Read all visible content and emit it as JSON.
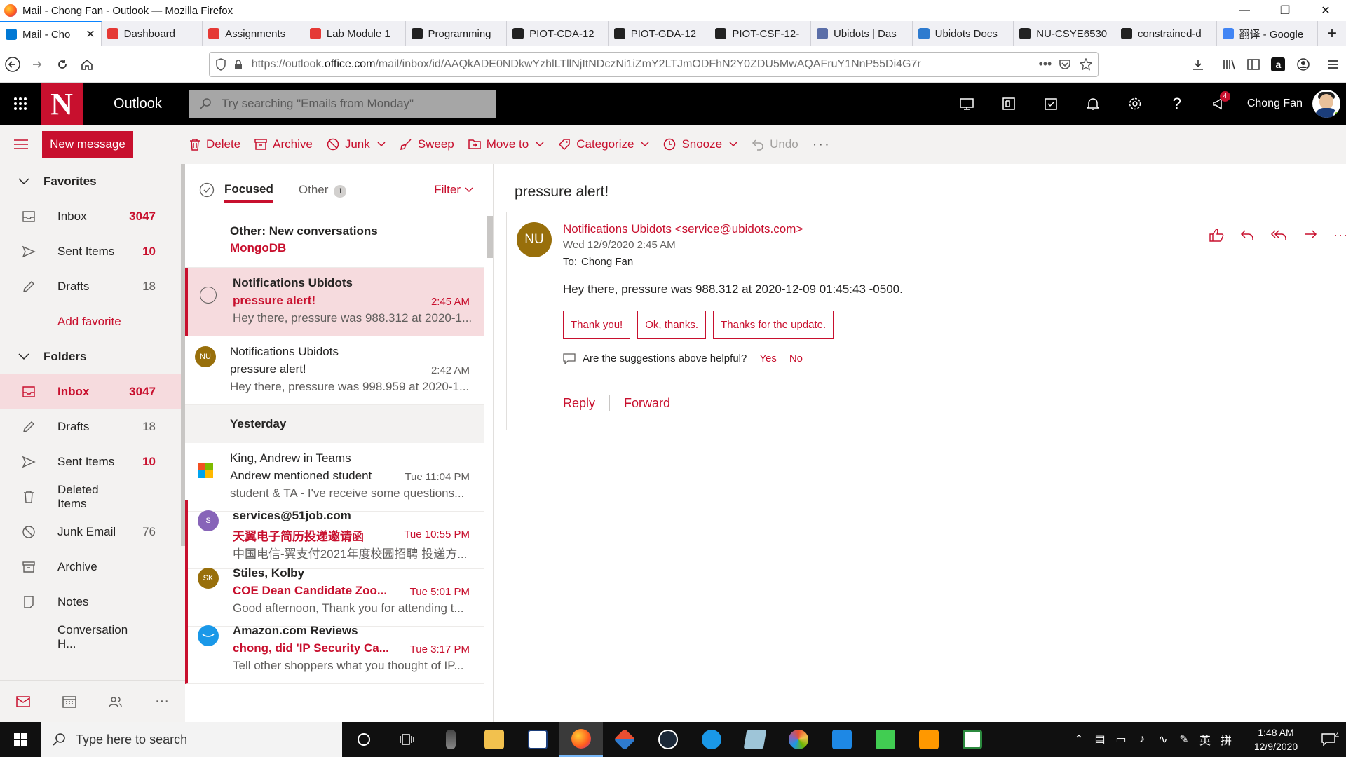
{
  "window": {
    "title": "Mail - Chong Fan - Outlook — Mozilla Firefox"
  },
  "browser": {
    "tabs": [
      {
        "label": "Mail - Cho",
        "color": "#0078d4",
        "active": true
      },
      {
        "label": "Dashboard",
        "color": "#e53935"
      },
      {
        "label": "Assignments",
        "color": "#e53935"
      },
      {
        "label": "Lab Module 1",
        "color": "#e53935"
      },
      {
        "label": "Programming",
        "color": "#222222"
      },
      {
        "label": "PIOT-CDA-12",
        "color": "#222222"
      },
      {
        "label": "PIOT-GDA-12",
        "color": "#222222"
      },
      {
        "label": "PIOT-CSF-12-",
        "color": "#222222"
      },
      {
        "label": "Ubidots | Das",
        "color": "#5b6ea8"
      },
      {
        "label": "Ubidots Docs",
        "color": "#2e7bcf"
      },
      {
        "label": "NU-CSYE6530",
        "color": "#222222"
      },
      {
        "label": "constrained-d",
        "color": "#222222"
      },
      {
        "label": "翻译 - Google",
        "color": "#4285f4"
      }
    ],
    "url_prefix": "https://outlook.",
    "url_domain": "office.com",
    "url_rest": "/mail/inbox/id/AAQkADE0NDkwYzhlLTllNjItNDczNi1iZmY2LTJmODFhN2Y0ZDU5MwAQAFruY1NnP55Di4G7r"
  },
  "outlook": {
    "app_name": "Outlook",
    "logo_letter": "N",
    "search_placeholder": "Try searching \"Emails from Monday\"",
    "user_name": "Chong Fan",
    "notification_count": "4"
  },
  "commands": {
    "new_message": "New message",
    "delete": "Delete",
    "archive": "Archive",
    "junk": "Junk",
    "sweep": "Sweep",
    "move_to": "Move to",
    "categorize": "Categorize",
    "snooze": "Snooze",
    "undo": "Undo"
  },
  "sidebar": {
    "favorites_label": "Favorites",
    "favorites": [
      {
        "label": "Inbox",
        "count": "3047",
        "red": true
      },
      {
        "label": "Sent Items",
        "count": "10",
        "red": true
      },
      {
        "label": "Drafts",
        "count": "18",
        "red": false
      }
    ],
    "add_favorite": "Add favorite",
    "folders_label": "Folders",
    "folders": [
      {
        "label": "Inbox",
        "count": "3047"
      },
      {
        "label": "Drafts",
        "count": "18"
      },
      {
        "label": "Sent Items",
        "count": "10"
      },
      {
        "label": "Deleted Items",
        "count": ""
      },
      {
        "label": "Junk Email",
        "count": "76"
      },
      {
        "label": "Archive",
        "count": ""
      },
      {
        "label": "Notes",
        "count": ""
      },
      {
        "label": "Conversation H...",
        "count": ""
      }
    ]
  },
  "message_list": {
    "tab_focused": "Focused",
    "tab_other": "Other",
    "other_count": "1",
    "filter": "Filter",
    "other_banner": {
      "title": "Other: New conversations",
      "sender": "MongoDB"
    },
    "yesterday_label": "Yesterday",
    "messages": [
      {
        "sender": "Notifications Ubidots",
        "subject": "pressure alert!",
        "time": "2:45 AM",
        "preview": "Hey there, pressure was 988.312 at 2020-1...",
        "initials": "",
        "avatar_color": ""
      },
      {
        "sender": "Notifications Ubidots",
        "subject": "pressure alert!",
        "time": "2:42 AM",
        "preview": "Hey there, pressure was 998.959 at 2020-1...",
        "initials": "NU",
        "avatar_color": "#986f0b"
      },
      {
        "sender": "King, Andrew in Teams",
        "subject": "Andrew mentioned student",
        "time": "Tue 11:04 PM",
        "preview": "student & TA - I've receive some questions...",
        "initials": "",
        "avatar_color": ""
      },
      {
        "sender": "services@51job.com",
        "subject": "天翼电子简历投递邀请函",
        "time": "Tue 10:55 PM",
        "preview": "中国电信-翼支付2021年度校园招聘 投递方...",
        "initials": "S",
        "avatar_color": "#8764b8"
      },
      {
        "sender": "Stiles, Kolby",
        "subject": "COE Dean Candidate Zoo...",
        "time": "Tue 5:01 PM",
        "preview": "Good afternoon, Thank you for attending t...",
        "initials": "SK",
        "avatar_color": "#986f0b"
      },
      {
        "sender": "Amazon.com Reviews",
        "subject": "chong, did 'IP Security Ca...",
        "time": "Tue 3:17 PM",
        "preview": "Tell other shoppers what you thought of IP...",
        "initials": "",
        "avatar_color": "#1a98e8"
      }
    ]
  },
  "reading": {
    "subject": "pressure alert!",
    "avatar": "NU",
    "from": "Notifications Ubidots <service@ubidots.com>",
    "date": "Wed 12/9/2020 2:45 AM",
    "to_label": "To:",
    "to": "Chong Fan",
    "body": "Hey there, pressure was 988.312 at 2020-12-09 01:45:43 -0500.",
    "suggestions": [
      "Thank you!",
      "Ok, thanks.",
      "Thanks for the update."
    ],
    "helpful_q": "Are the suggestions above helpful?",
    "yes": "Yes",
    "no": "No",
    "reply": "Reply",
    "forward": "Forward"
  },
  "taskbar": {
    "search_placeholder": "Type here to search",
    "ime_lang": "英",
    "ime_mode": "拼",
    "time": "1:48 AM",
    "date": "12/9/2020",
    "notif_count": "4"
  }
}
